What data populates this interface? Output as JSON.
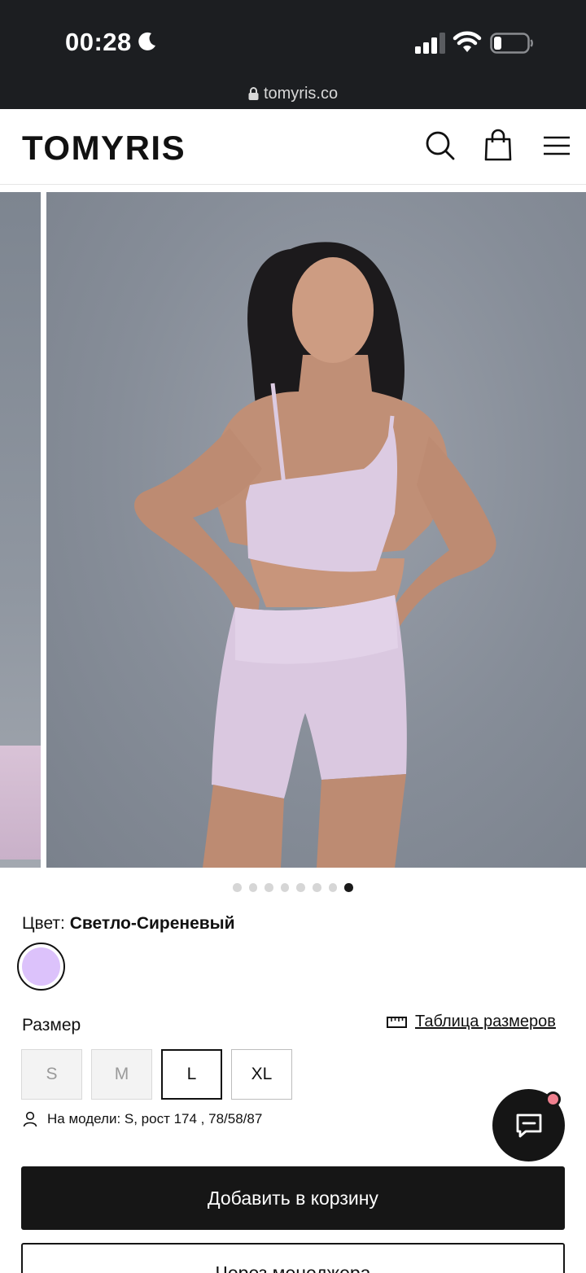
{
  "status_bar": {
    "time": "00:28",
    "url": "tomyris.co",
    "icons": [
      "moon-icon",
      "signal-icon",
      "wifi-icon",
      "battery-icon",
      "lock-icon"
    ]
  },
  "header": {
    "logo": "TOMYRIS",
    "icons": [
      "search-icon",
      "shopping-bag-icon",
      "hamburger-menu-icon"
    ]
  },
  "gallery": {
    "image_description": "model-wearing-light-lilac-crop-top-and-bike-shorts",
    "dot_count": 8,
    "active_index": 7
  },
  "color": {
    "label": "Цвет:",
    "value": "Светло-Сиреневый",
    "swatch_hex": "#dcc2fb"
  },
  "size": {
    "label": "Размер",
    "size_chart_link": "Таблица размеров",
    "options": [
      {
        "label": "S",
        "available": false,
        "selected": false
      },
      {
        "label": "M",
        "available": false,
        "selected": false
      },
      {
        "label": "L",
        "available": true,
        "selected": true
      },
      {
        "label": "XL",
        "available": true,
        "selected": false
      }
    ],
    "model_info": "На модели: S, рост 174 , 78/58/87"
  },
  "actions": {
    "add_to_cart": "Добавить в корзину",
    "via_manager": "Через менеджера"
  },
  "colors": {
    "status_bar_bg": "#1c1e21",
    "button_dark": "#161616",
    "chat_badge": "#ef7f8e"
  }
}
